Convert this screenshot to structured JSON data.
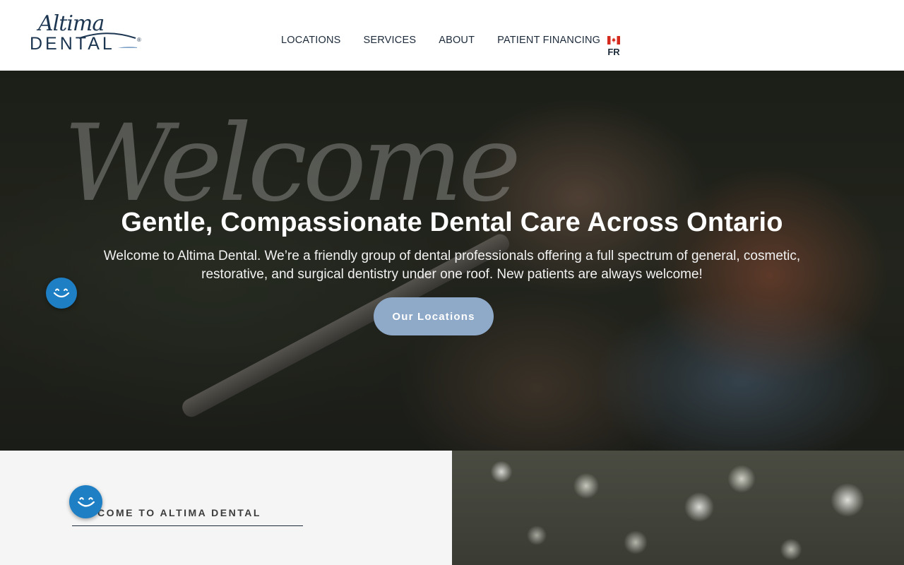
{
  "brand": {
    "script": "Altima",
    "word": "DENTAL",
    "reg": "®"
  },
  "nav": {
    "items": [
      {
        "label": "LOCATIONS"
      },
      {
        "label": "SERVICES"
      },
      {
        "label": "ABOUT"
      },
      {
        "label": "PATIENT FINANCING"
      }
    ],
    "language": {
      "label": "FR",
      "flag_icon": "canada-flag-icon"
    }
  },
  "hero": {
    "script_text": "Welcome",
    "title": "Gentle, Compassionate Dental Care Across Ontario",
    "subtitle": "Welcome to Altima Dental. We’re a friendly group of dental professionals offering a full spectrum of general, cosmetic, restorative, and surgical dentistry under one roof. New patients are always welcome!",
    "cta_label": "Our Locations"
  },
  "section": {
    "heading": "COME TO ALTIMA DENTAL"
  },
  "widgets": {
    "smile_icon": "smile-icon"
  },
  "colors": {
    "navy": "#1c3550",
    "button": "#8fa9c9",
    "badge": "#1f7fc4",
    "section_bg": "#f5f5f5"
  }
}
